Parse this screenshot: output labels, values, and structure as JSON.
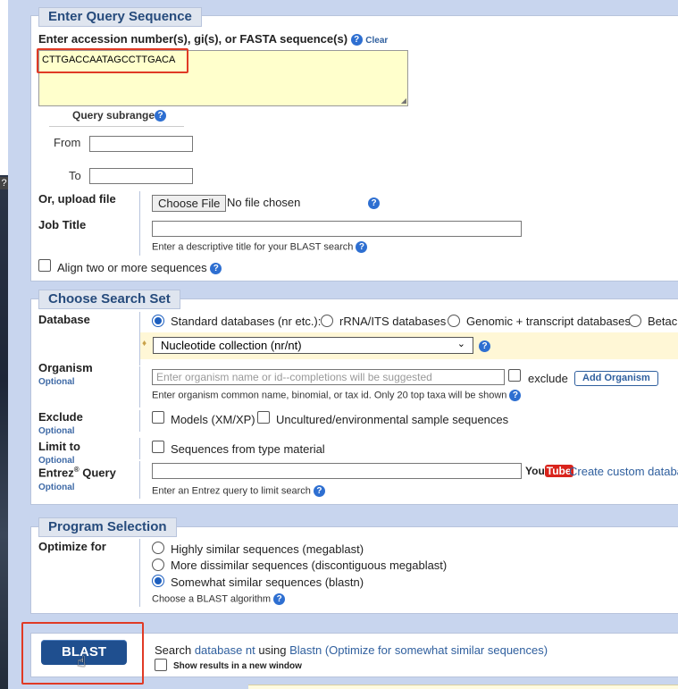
{
  "query_section": {
    "legend": "Enter Query Sequence",
    "label": "Enter accession number(s), gi(s), or FASTA sequence(s)",
    "clear_link": "Clear",
    "sequence": "CTTGACCAATAGCCTTGACA",
    "subrange_label": "Query subrange",
    "from_label": "From",
    "to_label": "To",
    "upload_label": "Or, upload file",
    "choose_file_button": "Choose File",
    "no_file_text": "No file chosen",
    "job_title_label": "Job Title",
    "job_title_hint": "Enter a descriptive title for your BLAST search",
    "align_two_label": "Align two or more sequences"
  },
  "search_set": {
    "legend": "Choose Search Set",
    "database_label": "Database",
    "db_options": [
      "Standard databases (nr etc.):",
      "rRNA/ITS databases",
      "Genomic + transcript databases",
      "Betac"
    ],
    "db_select_value": "Nucleotide collection (nr/nt)",
    "organism_label": "Organism",
    "optional": "Optional",
    "organism_placeholder": "Enter organism name or id--completions will be suggested",
    "exclude_label": "exclude",
    "add_organism_button": "Add Organism",
    "organism_hint": "Enter organism common name, binomial, or tax id. Only 20 top taxa will be shown",
    "exclude_section_label": "Exclude",
    "models_label": "Models (XM/XP)",
    "uncultured_label": "Uncultured/environmental sample sequences",
    "limit_label": "Limit to",
    "type_material_label": "Sequences from type material",
    "entrez_label": "Entrez",
    "entrez_sup": "®",
    "entrez_label2": " Query",
    "youtube_you": "You",
    "youtube_tube": "Tube",
    "custom_db_link": "Create custom databa",
    "entrez_hint": "Enter an Entrez query to limit search"
  },
  "program": {
    "legend": "Program Selection",
    "optimize_label": "Optimize for",
    "options": [
      "Highly similar sequences (megablast)",
      "More dissimilar sequences (discontiguous megablast)",
      "Somewhat similar sequences (blastn)"
    ],
    "selected_index": 2,
    "algorithm_hint": "Choose a BLAST algorithm"
  },
  "submit": {
    "blast_button": "BLAST",
    "search_prefix": "Search ",
    "database_link": "database nt",
    "using_text": " using ",
    "program_link": "Blastn (Optimize for somewhat similar sequences)",
    "new_window_label": "Show results in a new window"
  },
  "colors": {
    "highlight_box": "#e03a25",
    "panel_legend": "#264b7c",
    "blast_button": "#1f4f8f",
    "textarea_bg": "#ffffcc"
  }
}
